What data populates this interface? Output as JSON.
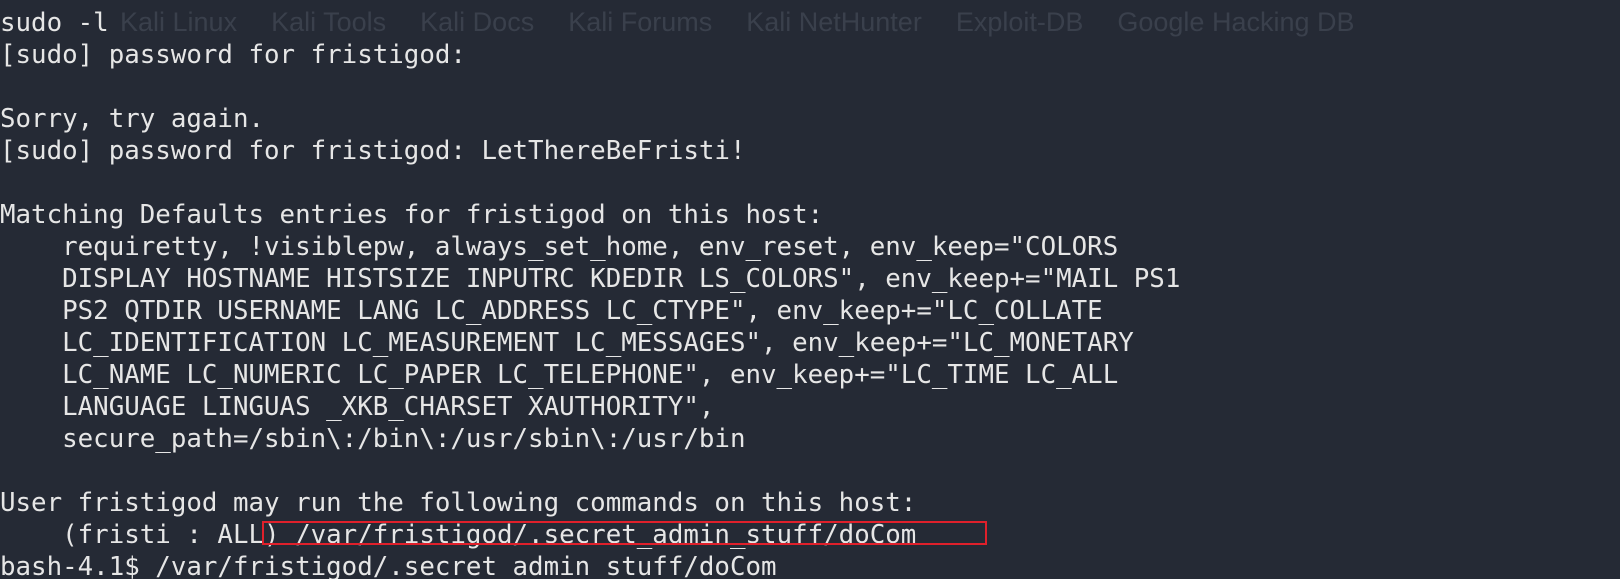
{
  "background_bar": {
    "items": [
      "Kali Linux",
      "Kali Tools",
      "Kali Docs",
      "Kali Forums",
      "Kali NetHunter",
      "Exploit-DB",
      "Google Hacking DB"
    ]
  },
  "terminal": {
    "lines": [
      "sudo -l",
      "[sudo] password for fristigod:",
      "",
      "Sorry, try again.",
      "[sudo] password for fristigod: LetThereBeFristi!",
      "",
      "Matching Defaults entries for fristigod on this host:",
      "    requiretty, !visiblepw, always_set_home, env_reset, env_keep=\"COLORS",
      "    DISPLAY HOSTNAME HISTSIZE INPUTRC KDEDIR LS_COLORS\", env_keep+=\"MAIL PS1",
      "    PS2 QTDIR USERNAME LANG LC_ADDRESS LC_CTYPE\", env_keep+=\"LC_COLLATE",
      "    LC_IDENTIFICATION LC_MEASUREMENT LC_MESSAGES\", env_keep+=\"LC_MONETARY",
      "    LC_NAME LC_NUMERIC LC_PAPER LC_TELEPHONE\", env_keep+=\"LC_TIME LC_ALL",
      "    LANGUAGE LINGUAS _XKB_CHARSET XAUTHORITY\",",
      "    secure_path=/sbin\\:/bin\\:/usr/sbin\\:/usr/bin",
      "",
      "User fristigod may run the following commands on this host:",
      "    (fristi : ALL) /var/fristigod/.secret_admin_stuff/doCom",
      "bash-4.1$ /var/fristigod/.secret_admin_stuff/doCom"
    ]
  },
  "annotation": {
    "highlight_color": "#e0202b"
  }
}
